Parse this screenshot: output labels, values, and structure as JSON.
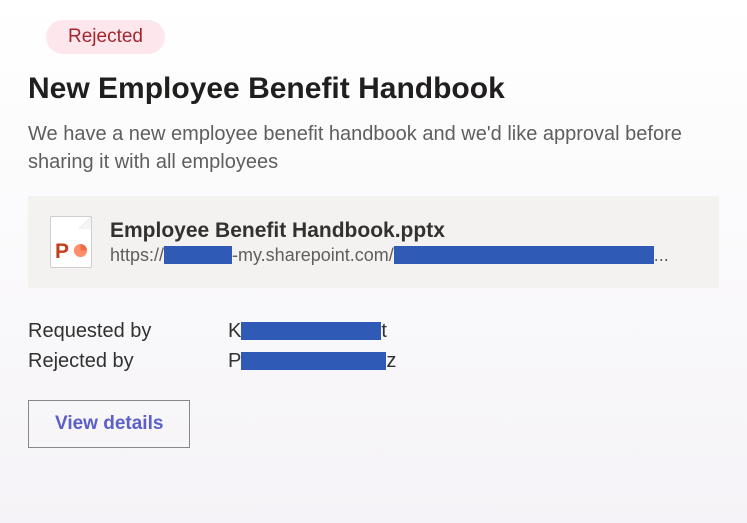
{
  "status": {
    "label": "Rejected"
  },
  "title": "New Employee Benefit Handbook",
  "description": "We have a new employee benefit handbook and we'd like approval before sharing it with all employees",
  "attachment": {
    "file_name": "Employee Benefit Handbook.pptx",
    "url_prefix": "https://",
    "url_middle": "-my.sharepoint.com/",
    "url_suffix": "...",
    "icon_letter": "P"
  },
  "meta": {
    "requested_label": "Requested by",
    "requested_value_prefix": "K",
    "requested_value_suffix": "t",
    "rejected_label": "Rejected by",
    "rejected_value_prefix": "P",
    "rejected_value_suffix": "z"
  },
  "actions": {
    "view_details_label": "View details"
  }
}
